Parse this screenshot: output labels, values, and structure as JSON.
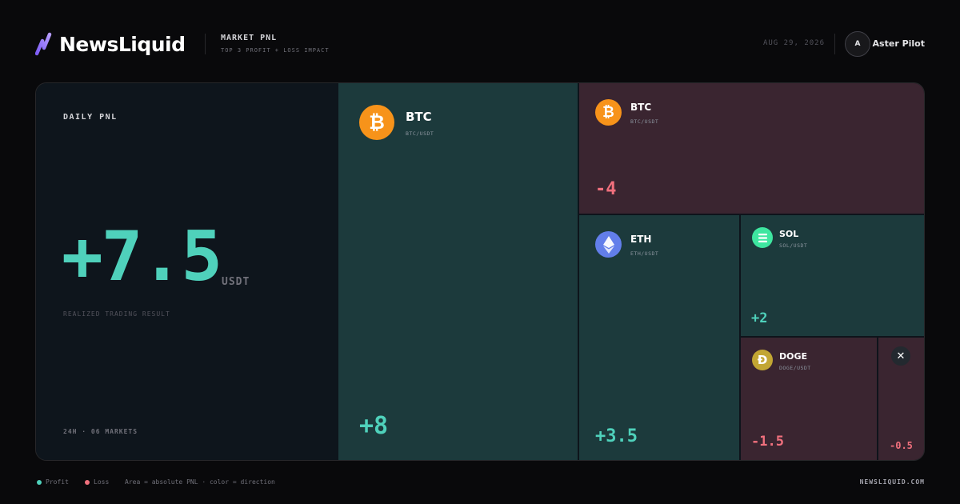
{
  "brand": {
    "name": "NewsLiquid"
  },
  "header": {
    "section_title": "MARKET PNL",
    "section_subtitle": "TOP 3 PROFIT + LOSS IMPACT",
    "date": "AUG 29, 2026",
    "avatar_initial": "A",
    "username": "Aster Pilot"
  },
  "summary": {
    "label": "DAILY PNL",
    "value": "+7.5",
    "unit": "USDT",
    "caption": "REALIZED TRADING RESULT",
    "footer": "24H · 06 MARKETS"
  },
  "tiles": [
    {
      "symbol": "BTC",
      "pair": "BTC/USDT",
      "pnl": "+8",
      "direction": "profit",
      "icon": "bitcoin-icon",
      "icon_color": "#f7931a"
    },
    {
      "symbol": "BTC",
      "pair": "BTC/USDT",
      "pnl": "-4",
      "direction": "loss",
      "icon": "bitcoin-icon",
      "icon_color": "#f7931a"
    },
    {
      "symbol": "ETH",
      "pair": "ETH/USDT",
      "pnl": "+3.5",
      "direction": "profit",
      "icon": "ethereum-icon",
      "icon_color": "#627eea"
    },
    {
      "symbol": "SOL",
      "pair": "SOL/USDT",
      "pnl": "+2",
      "direction": "profit",
      "icon": "solana-icon",
      "icon_color": "#3ee6a0"
    },
    {
      "symbol": "DOGE",
      "pair": "DOGE/USDT",
      "pnl": "-1.5",
      "direction": "loss",
      "icon": "dogecoin-icon",
      "icon_color": "#c2a633"
    },
    {
      "symbol": "",
      "pair": "",
      "pnl": "-0.5",
      "direction": "loss",
      "icon": "xrp-icon",
      "icon_color": "#23292f"
    }
  ],
  "colors": {
    "profit": "#4fd1bb",
    "loss": "#f0707d",
    "profit_tile": "#1c3a3c",
    "loss_tile": "#3a2530"
  },
  "footer": {
    "legend_profit": "Profit",
    "legend_loss": "Loss",
    "note": "Area = absolute PNL · color = direction",
    "site": "NEWSLIQUID.COM"
  }
}
